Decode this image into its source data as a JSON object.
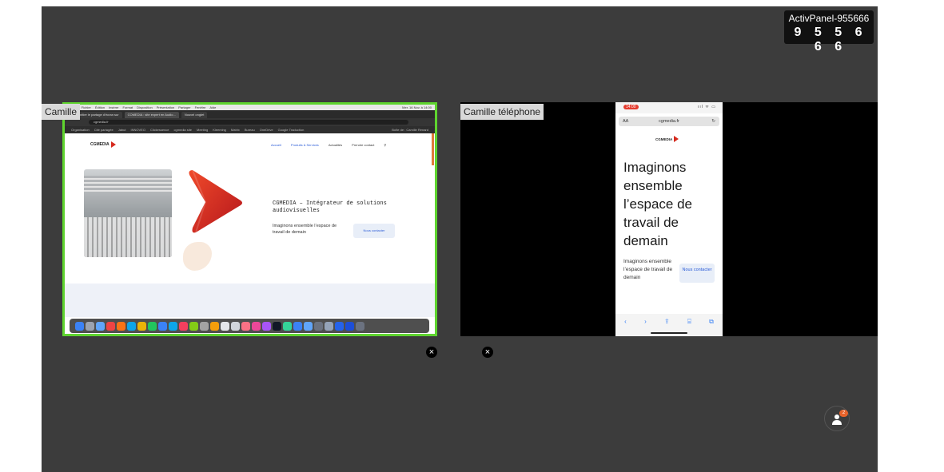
{
  "panel": {
    "name": "ActivPanel-955666",
    "code": "9 5 5 6 6 6"
  },
  "tiles": [
    {
      "label": "Camille",
      "close": "×"
    },
    {
      "label": "Camille téléphone",
      "close": "×"
    }
  ],
  "mac": {
    "menu": [
      "",
      "Pages",
      "Fichier",
      "Édition",
      "Insérer",
      "Format",
      "Disposition",
      "Présentation",
      "Partager",
      "Fenêtre",
      "Aide"
    ],
    "clock": "Mer. 16 Nov. à 14:00",
    "tabs": [
      "Initier le partage d’écran sur",
      "COMEDIA : site expert en Audio...",
      "Nouvel onglet"
    ],
    "url": "cgmedia.fr",
    "bookmarks": [
      "Organisation",
      "Cité partagée",
      "Jabut",
      "INNOVEO",
      "Clickessence",
      "cgmedia site",
      "Meeting",
      "Kleeming",
      "Matrix",
      "Bureau",
      "OneDrive",
      "Google Traduction"
    ],
    "bookmarks_right": "Boîte de : Camille Renard",
    "website": {
      "logo": "CGMEDIA",
      "nav": [
        "Accueil",
        "Produits & Services",
        "Actualités",
        "Prendre contact"
      ],
      "title": "CGMEDIA – Intégrateur de solutions audiovisuelles",
      "subtitle": "Imaginons ensemble l’espace de travail de demain",
      "cta": "Nous contacter"
    },
    "dock_colors": [
      "#3b82f6",
      "#9ca3af",
      "#60a5fa",
      "#ef4444",
      "#f97316",
      "#0ea5e9",
      "#eab308",
      "#22c55e",
      "#3b82f6",
      "#0ea5e9",
      "#f43f5e",
      "#84cc16",
      "#a3a3a3",
      "#f59e0b",
      "#e5e7eb",
      "#d1d5db",
      "#fb7185",
      "#ec4899",
      "#a855f7",
      "#111827",
      "#34d399",
      "#3b82f6",
      "#60a5fa",
      "#6b7280",
      "#94a3b8",
      "#2563eb",
      "#1d4ed8",
      "#6b7280"
    ]
  },
  "phone": {
    "time": "14:00",
    "signal": "ııl ᯤ ▭",
    "aa": "AA",
    "url": "cgmedia.fr",
    "reload": "↻",
    "logo": "CGMEDIA",
    "hero": "Imaginons ensemble l’espace de travail de demain",
    "sub": "Imaginons ensemble l’espace de travail de demain",
    "cta": "Nous contacter",
    "toolbar": [
      "‹",
      "›",
      "⇪",
      "⌸",
      "⧉"
    ]
  },
  "participants": {
    "count": "2"
  }
}
